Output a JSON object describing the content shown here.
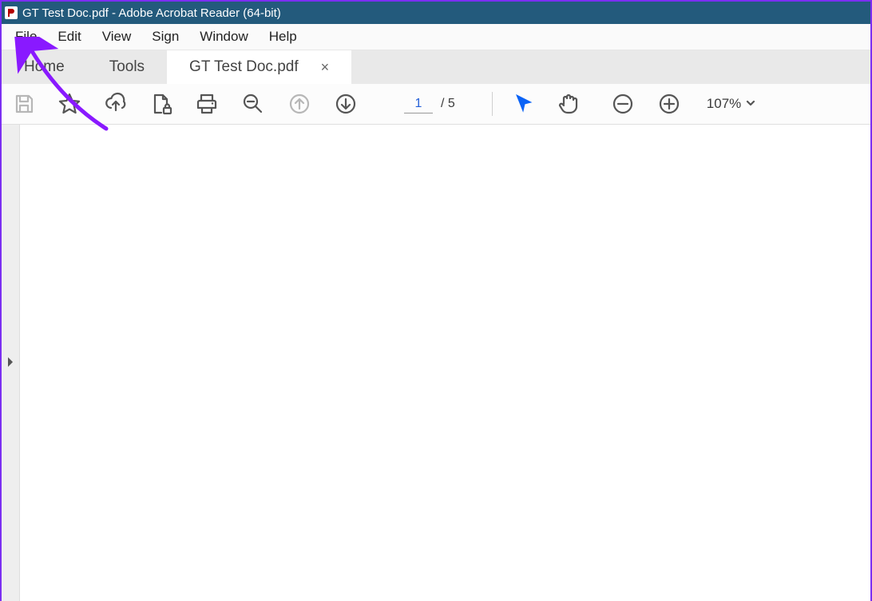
{
  "title": "GT Test Doc.pdf - Adobe Acrobat Reader (64-bit)",
  "menubar": {
    "file": "File",
    "edit": "Edit",
    "view": "View",
    "sign": "Sign",
    "window": "Window",
    "help": "Help"
  },
  "tabs": {
    "home": "Home",
    "tools": "Tools",
    "doc": "GT Test Doc.pdf"
  },
  "pages": {
    "current": "1",
    "total": "/ 5"
  },
  "zoom": {
    "label": "107%"
  }
}
